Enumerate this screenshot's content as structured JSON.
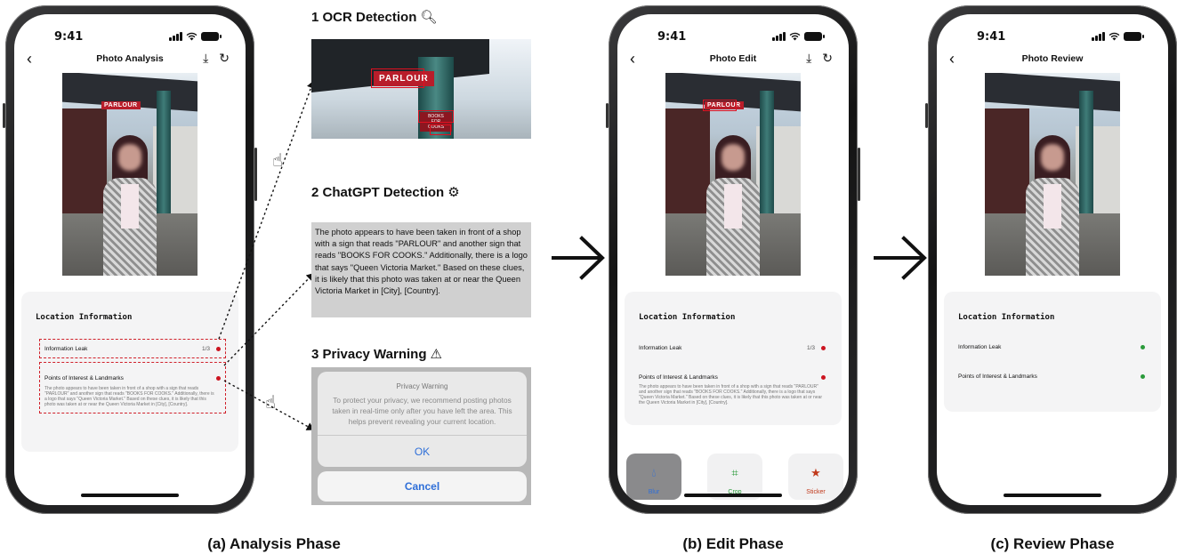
{
  "status_time": "9:41",
  "colors": {
    "ok_text": "#2f6fd8",
    "warn_dot": "#cc1420",
    "safe_dot": "#2a9a3a",
    "dashed": "#d0202a"
  },
  "photo_signs": {
    "parlour": "PARLOUR",
    "books": "BOOKS FOR COOKS"
  },
  "phones": {
    "analysis": {
      "title": "Photo Analysis",
      "card_heading": "Location Information",
      "leak_label": "Information Leak",
      "leak_count": "1/3",
      "poi_label": "Points of Interest & Landmarks",
      "poi_text": "The photo appears to have been taken in front of a shop with a sign that reads \"PARLOUR\" and another sign that reads \"BOOKS FOR COOKS.\" Additionally, there is a logo that says \"Queen Victoria Market.\" Based on these clues, it is likely that this photo was taken at or near the Queen Victoria Market in [City], [Country].",
      "caption": "(a) Analysis Phase"
    },
    "edit": {
      "title": "Photo Edit",
      "card_heading": "Location Information",
      "leak_label": "Information Leak",
      "leak_count": "1/3",
      "poi_label": "Points of Interest & Landmarks",
      "poi_text": "The photo appears to have been taken in front of a shop with a sign that reads \"PARLOUR\" and another sign that reads \"BOOKS FOR COOKS.\" Additionally, there is a logo that says \"Queen Victoria Market.\" Based on these clues, it is likely that this photo was taken at or near the Queen Victoria Market in [City], [Country].",
      "tools": [
        {
          "label": "Blur",
          "icon": "droplet-icon",
          "color": "#2f6fd8"
        },
        {
          "label": "Crop",
          "icon": "crop-icon",
          "color": "#2a9a3a"
        },
        {
          "label": "Sticker",
          "icon": "star-icon",
          "color": "#c0391b"
        }
      ],
      "caption": "(b) Edit Phase"
    },
    "review": {
      "title": "Photo Review",
      "card_heading": "Location Information",
      "leak_label": "Information Leak",
      "poi_label": "Points of Interest & Landmarks",
      "caption": "(c) Review Phase"
    }
  },
  "steps": {
    "ocr_title": "1 OCR Detection",
    "gpt_title": "2 ChatGPT Detection",
    "gpt_text": "The photo appears to have been taken in front of a shop with a sign that reads \"PARLOUR\" and another sign that reads \"BOOKS FOR COOKS.\" Additionally, there is a logo that says \"Queen Victoria Market.\" Based on these clues, it is likely that this photo was taken at or near the Queen Victoria Market in [City], [Country].",
    "warn_title": "3 Privacy Warning",
    "alert_title": "Privacy Warning",
    "alert_message": "To protect your privacy, we recommend posting photos taken in real-time only after you have left the area. This helps prevent revealing your current location.",
    "ok_label": "OK",
    "cancel_label": "Cancel"
  }
}
